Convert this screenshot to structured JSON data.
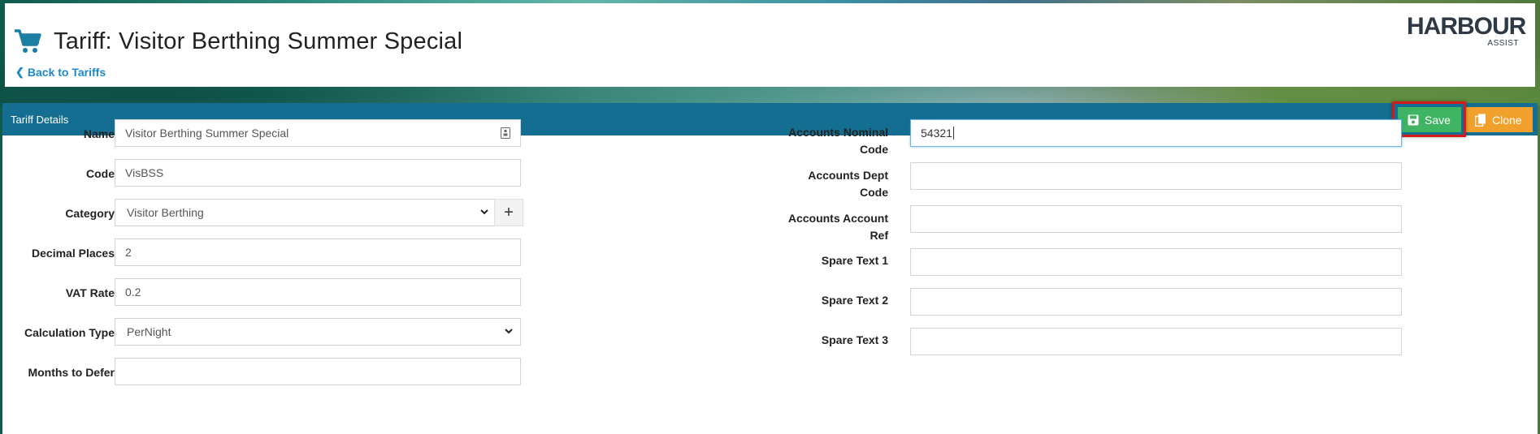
{
  "header": {
    "title": "Tariff: Visitor Berthing Summer Special",
    "back_link": "Back to Tariffs",
    "logo_word": "HARBOUR",
    "logo_sub": "ASSIST"
  },
  "panel": {
    "title": "Tariff Details",
    "save_label": "Save",
    "clone_label": "Clone"
  },
  "left_fields": [
    {
      "label": "Name",
      "value": "Visitor Berthing Summer Special"
    },
    {
      "label": "Code",
      "value": "VisBSS"
    },
    {
      "label": "Category",
      "value": "Visitor Berthing"
    },
    {
      "label": "Decimal Places",
      "value": "2"
    },
    {
      "label": "VAT Rate",
      "value": "0.2"
    },
    {
      "label": "Calculation Type",
      "value": "PerNight"
    },
    {
      "label": "Months to Defer",
      "value": ""
    }
  ],
  "right_fields": [
    {
      "label_line1": "Accounts Nominal",
      "label_line2": "Code",
      "value": "54321"
    },
    {
      "label_line1": "Accounts Dept",
      "label_line2": "Code",
      "value": ""
    },
    {
      "label_line1": "Accounts Account",
      "label_line2": "Ref",
      "value": ""
    },
    {
      "label_line1": "Spare Text 1",
      "label_line2": "",
      "value": ""
    },
    {
      "label_line1": "Spare Text 2",
      "label_line2": "",
      "value": ""
    },
    {
      "label_line1": "Spare Text 3",
      "label_line2": "",
      "value": ""
    }
  ],
  "colors": {
    "panel_bar": "#136e91",
    "save": "#3fb462",
    "clone": "#f1a12b",
    "link": "#1e88c8",
    "highlight": "#d61a1a"
  }
}
